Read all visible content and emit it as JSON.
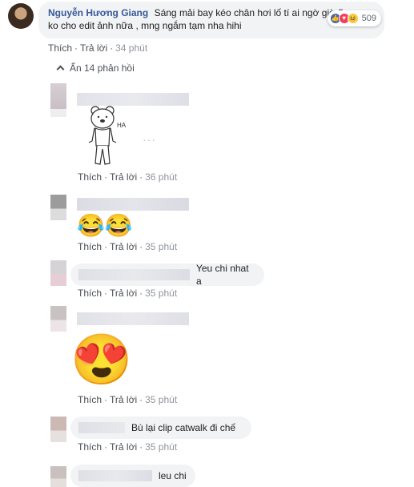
{
  "main_comment": {
    "author": "Nguyễn Hương Giang",
    "text_line1": "Sáng mải bay kéo chân hơi lố tí ai ngờ giờ fb",
    "text_line2": "ko cho edit ảnh nữa , mng ngắm tạm nha hihi",
    "reaction_icons": [
      "like-icon",
      "love-icon",
      "haha-icon"
    ],
    "reaction_count": "509",
    "actions": {
      "like": "Thích",
      "reply": "Trả lời",
      "time": "34 phút"
    }
  },
  "hide_replies": "Ẩn 14 phản hồi",
  "replies": [
    {
      "sticker": "bear-sticker",
      "sticker_text": "HA",
      "actions": {
        "like": "Thích",
        "reply": "Trả lời",
        "time": "36 phút"
      }
    },
    {
      "emoji": "😂😂",
      "actions": {
        "like": "Thích",
        "reply": "Trả lời",
        "time": "35 phút"
      }
    },
    {
      "text": "Yeu chi nhat a",
      "actions": {
        "like": "Thích",
        "reply": "Trả lời",
        "time": "35 phút"
      }
    },
    {
      "emoji": "😍",
      "actions": {
        "like": "Thích",
        "reply": "Trả lời",
        "time": "35 phút"
      }
    },
    {
      "text": "Bù lại clip catwalk đi chế",
      "actions": {
        "like": "Thích",
        "reply": "Trả lời",
        "time": "35 phút"
      }
    },
    {
      "text": "leu chi"
    }
  ],
  "colors": {
    "author": "#365899",
    "bubble": "#f2f3f5",
    "muted": "#90949c",
    "link": "#4b4f56"
  }
}
